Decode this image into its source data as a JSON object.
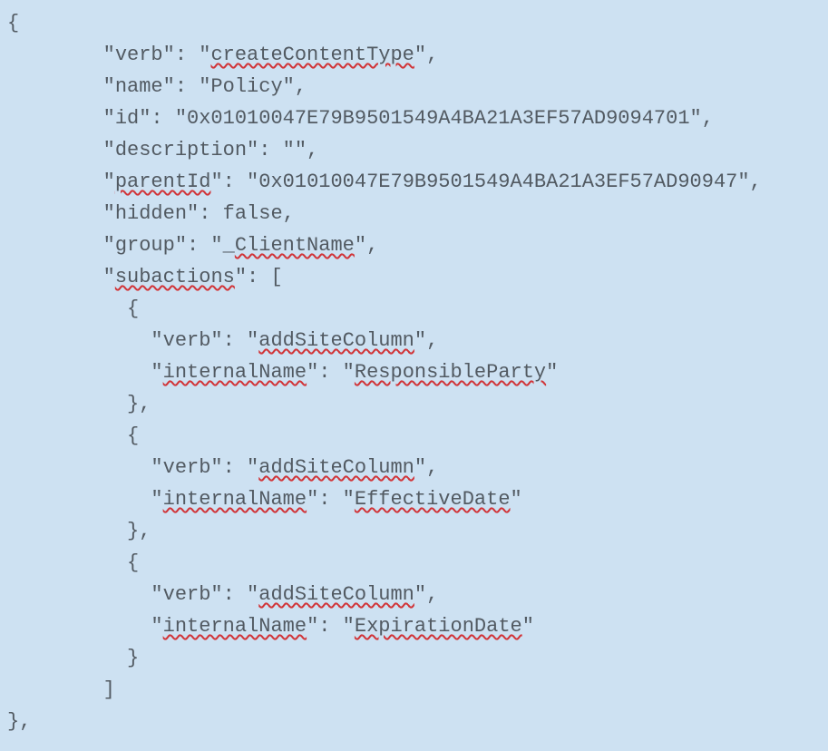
{
  "code": {
    "open_brace": "{",
    "line_verb_prefix": "        \"verb\": \"",
    "line_verb_value": "createContentType",
    "line_verb_suffix": "\",",
    "line_name": "        \"name\": \"Policy\",",
    "line_id": "        \"id\": \"0x01010047E79B9501549A4BA21A3EF57AD9094701\",",
    "line_description": "        \"description\": \"\",",
    "line_parentId_prefix": "        \"",
    "line_parentId_key": "parentId",
    "line_parentId_suffix": "\": \"0x01010047E79B9501549A4BA21A3EF57AD90947\",",
    "line_hidden": "        \"hidden\": false,",
    "line_group_prefix": "        \"group\": \"_",
    "line_group_value": "ClientName",
    "line_group_suffix": "\",",
    "line_subactions_prefix": "        \"",
    "line_subactions_key": "subactions",
    "line_subactions_suffix": "\": [",
    "sub_open": "          {",
    "sub_verb_prefix": "            \"verb\": \"",
    "sub_verb_value": "addSiteColumn",
    "sub_verb_suffix": "\",",
    "sub_iname_prefix": "            \"",
    "sub_iname_key": "internalName",
    "sub_iname_mid": "\": \"",
    "sub_iname_suffix": "\"",
    "sub1_value": "ResponsibleParty",
    "sub2_value": "EffectiveDate",
    "sub3_value": "ExpirationDate",
    "sub_close_comma": "          },",
    "sub_close": "          }",
    "array_close": "        ]",
    "close_brace_comma": "},"
  }
}
